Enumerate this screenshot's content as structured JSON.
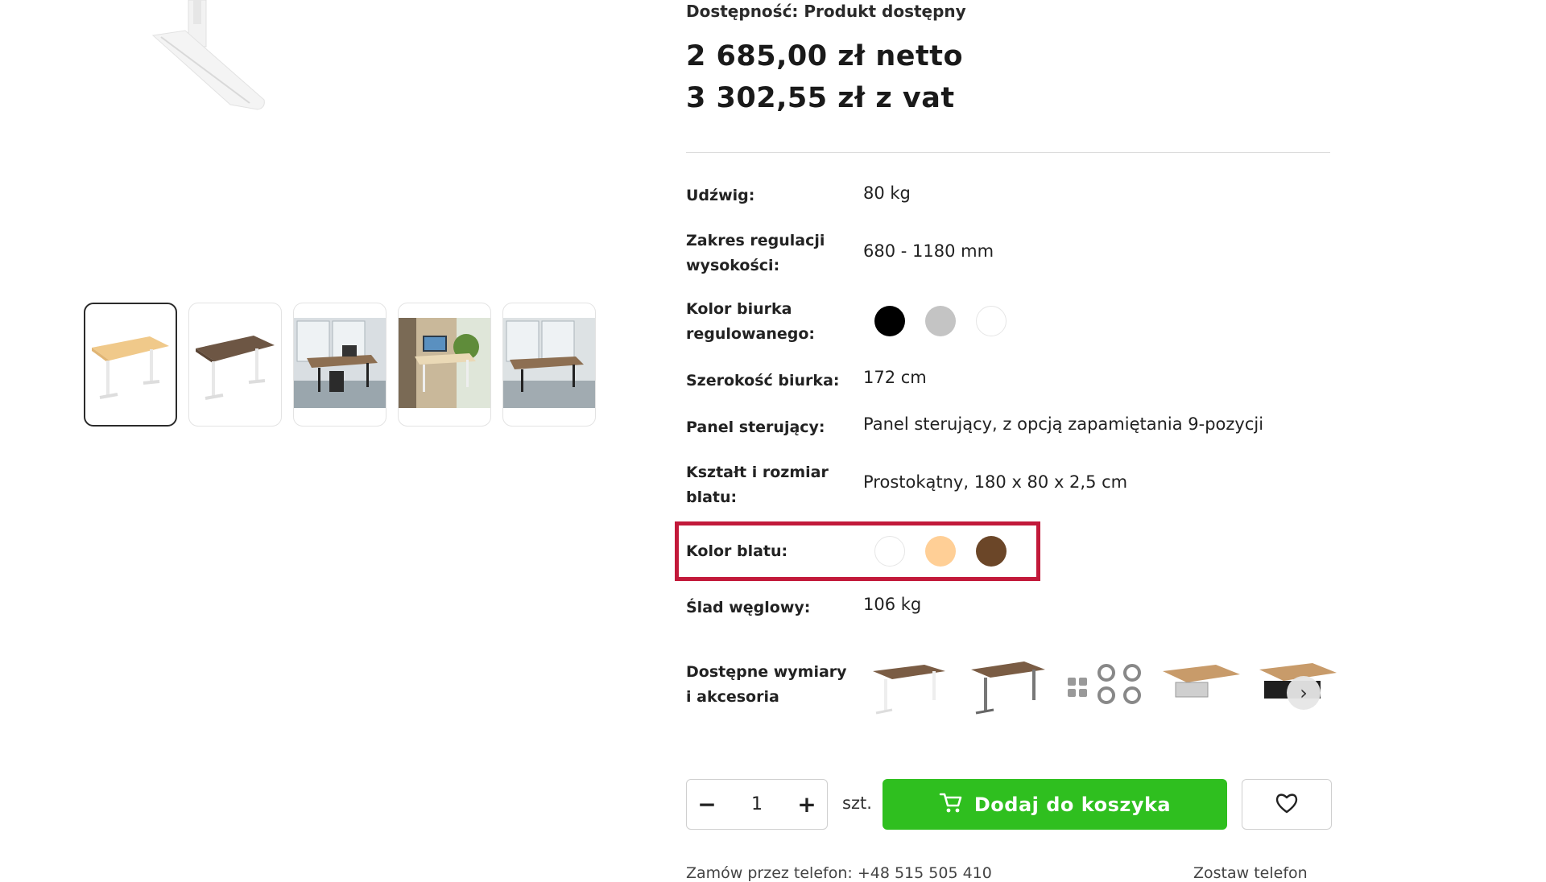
{
  "product": {
    "availability": "Dostępność: Produkt dostępny",
    "price_net": "2 685,00 zł netto",
    "price_gross": "3 302,55 zł z vat"
  },
  "specs": [
    {
      "label": "Udźwig:",
      "value": "80 kg"
    },
    {
      "label": "Zakres regulacji wysokości:",
      "value": "680 - 1180 mm"
    },
    {
      "label": "Kolor biurka regulowanego:",
      "swatches": [
        "#000000",
        "#c4c4c4",
        "#ffffff"
      ]
    },
    {
      "label": "Szerokość biurka:",
      "value": "172 cm"
    },
    {
      "label": "Panel sterujący:",
      "value": "Panel sterujący, z opcją zapamiętania 9-pozycji"
    },
    {
      "label": "Kształt i rozmiar blatu:",
      "value": "Prostokątny, 180 x 80 x 2,5 cm"
    },
    {
      "label": "Kolor blatu:",
      "swatches": [
        "#ffffff",
        "#ffcf96",
        "#6b4628"
      ]
    },
    {
      "label": "Ślad węglowy:",
      "value": "106 kg"
    },
    {
      "label": "Dostępne wymiary i akcesoria"
    }
  ],
  "highlight_color": "#c2193a",
  "accessories": [
    "walnut-desk-white-frame",
    "walnut-desk-grey-frame",
    "castor-wheels-set",
    "cable-tray-wood",
    "desk-drawer-black"
  ],
  "thumbnails": [
    "beech-desk-white-frame",
    "walnut-desk-white-frame",
    "office-photo-black-frame",
    "office-photo-plants",
    "office-photo-window"
  ],
  "cart": {
    "quantity": "1",
    "minus": "−",
    "plus": "+",
    "unit": "szt.",
    "add_label": "Dodaj do koszyka",
    "button_color": "#2fbf1f"
  },
  "footer_partial": {
    "left": "Zamów przez telefon: +48 515 505 410",
    "right": "Zostaw telefon"
  }
}
